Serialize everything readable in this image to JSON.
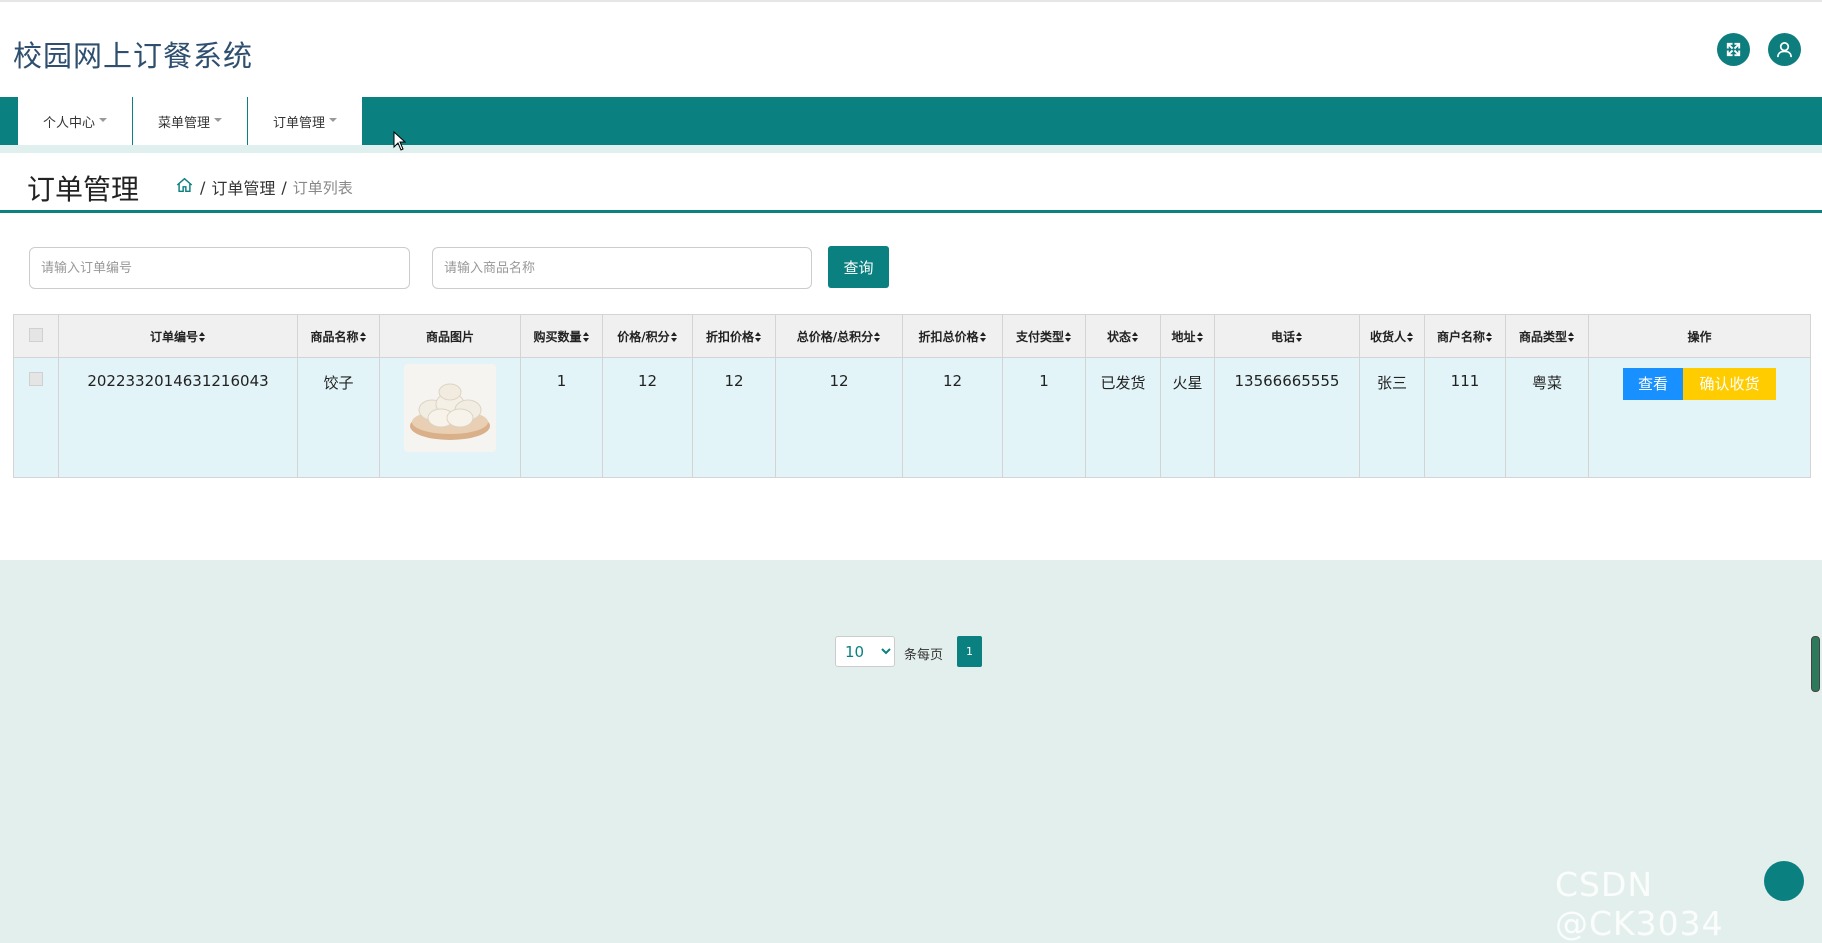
{
  "header": {
    "title": "校园网上订餐系统",
    "icons": [
      "fullscreen-icon",
      "user-icon"
    ]
  },
  "nav": {
    "items": [
      {
        "label": "个人中心"
      },
      {
        "label": "菜单管理"
      },
      {
        "label": "订单管理"
      }
    ]
  },
  "page": {
    "title": "订单管理",
    "breadcrumb": {
      "home_icon": "home-icon",
      "separator": "/",
      "parent": "订单管理",
      "current": "订单列表"
    }
  },
  "search": {
    "order_no_placeholder": "请输入订单编号",
    "product_name_placeholder": "请输入商品名称",
    "query_label": "查询"
  },
  "table": {
    "columns": [
      "订单编号",
      "商品名称",
      "商品图片",
      "购买数量",
      "价格/积分",
      "折扣价格",
      "总价格/总积分",
      "折扣总价格",
      "支付类型",
      "状态",
      "地址",
      "电话",
      "收货人",
      "商户名称",
      "商品类型",
      "操作"
    ],
    "rows": [
      {
        "order_no": "2022332014631216043",
        "product_name": "饺子",
        "image": "dumplings-image",
        "quantity": "1",
        "price": "12",
        "discount_price": "12",
        "total_price": "12",
        "discount_total": "12",
        "pay_type": "1",
        "status": "已发货",
        "address": "火星",
        "phone": "13566665555",
        "receiver": "张三",
        "merchant": "111",
        "category": "粤菜",
        "actions": {
          "view": "查看",
          "confirm": "确认收货"
        }
      }
    ]
  },
  "pagination": {
    "page_size": "10",
    "page_size_label": "条每页",
    "current_page": "1"
  },
  "watermark": "CSDN @CK3034",
  "colors": {
    "primary": "#0a8080",
    "view_button": "#1890ff",
    "confirm_button": "#ffcc00",
    "row_bg": "#e2f4f8"
  }
}
